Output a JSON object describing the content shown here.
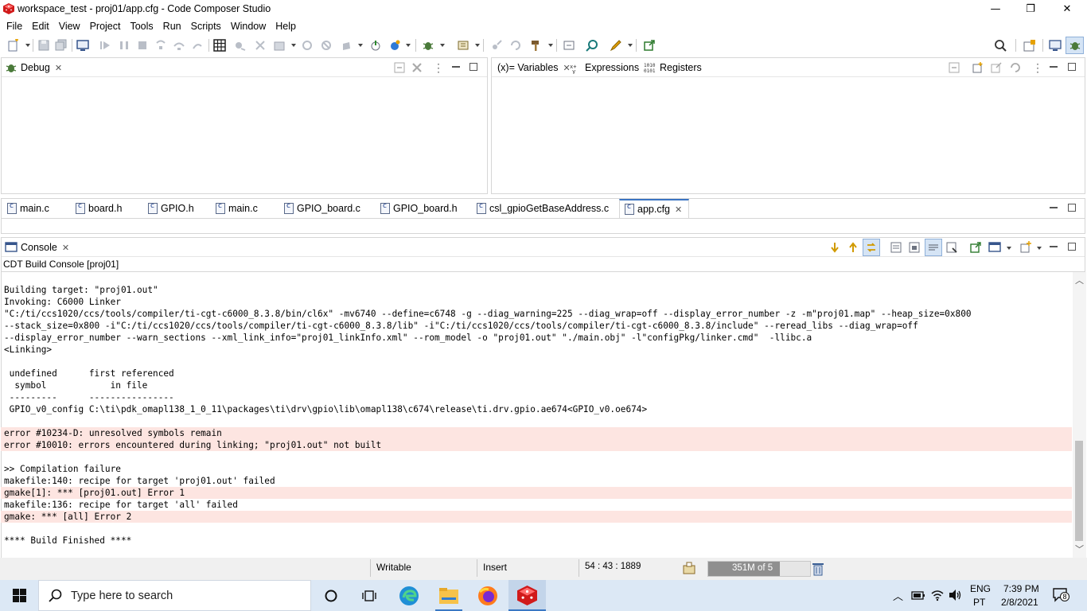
{
  "window": {
    "title": "workspace_test - proj01/app.cfg - Code Composer Studio",
    "minimize": "—",
    "restore": "❐",
    "close": "✕"
  },
  "menu": [
    "File",
    "Edit",
    "View",
    "Project",
    "Tools",
    "Run",
    "Scripts",
    "Window",
    "Help"
  ],
  "debug_view": {
    "tab": "Debug"
  },
  "variables_view": {
    "tabs": [
      "(x)= Variables",
      "Expressions",
      "Registers"
    ]
  },
  "editor": {
    "tabs": [
      "main.c",
      "board.h",
      "GPIO.h",
      "main.c",
      "GPIO_board.c",
      "GPIO_board.h",
      "csl_gpioGetBaseAddress.c",
      "app.cfg"
    ],
    "active_tab": "app.cfg"
  },
  "console": {
    "tab": "Console",
    "subtitle": "CDT Build Console [proj01]",
    "lines": [
      {
        "text": "Building target: \"proj01.out\"",
        "error": false
      },
      {
        "text": "Invoking: C6000 Linker",
        "error": false
      },
      {
        "text": "\"C:/ti/ccs1020/ccs/tools/compiler/ti-cgt-c6000_8.3.8/bin/cl6x\" -mv6740 --define=c6748 -g --diag_warning=225 --diag_wrap=off --display_error_number -z -m\"proj01.map\" --heap_size=0x800",
        "error": false
      },
      {
        "text": "--stack_size=0x800 -i\"C:/ti/ccs1020/ccs/tools/compiler/ti-cgt-c6000_8.3.8/lib\" -i\"C:/ti/ccs1020/ccs/tools/compiler/ti-cgt-c6000_8.3.8/include\" --reread_libs --diag_wrap=off",
        "error": false
      },
      {
        "text": "--display_error_number --warn_sections --xml_link_info=\"proj01_linkInfo.xml\" --rom_model -o \"proj01.out\" \"./main.obj\" -l\"configPkg/linker.cmd\"  -llibc.a",
        "error": false
      },
      {
        "text": "<Linking>",
        "error": false
      },
      {
        "text": "",
        "error": false
      },
      {
        "text": " undefined      first referenced",
        "error": false
      },
      {
        "text": "  symbol            in file",
        "error": false
      },
      {
        "text": " ---------      ----------------",
        "error": false
      },
      {
        "text": " GPIO_v0_config C:\\ti\\pdk_omapl138_1_0_11\\packages\\ti\\drv\\gpio\\lib\\omapl138\\c674\\release\\ti.drv.gpio.ae674<GPIO_v0.oe674>",
        "error": false
      },
      {
        "text": "",
        "error": false
      },
      {
        "text": "error #10234-D: unresolved symbols remain",
        "error": true
      },
      {
        "text": "error #10010: errors encountered during linking; \"proj01.out\" not built",
        "error": true
      },
      {
        "text": "",
        "error": false
      },
      {
        "text": ">> Compilation failure",
        "error": false
      },
      {
        "text": "makefile:140: recipe for target 'proj01.out' failed",
        "error": false
      },
      {
        "text": "gmake[1]: *** [proj01.out] Error 1",
        "error": true
      },
      {
        "text": "makefile:136: recipe for target 'all' failed",
        "error": false
      },
      {
        "text": "gmake: *** [all] Error 2",
        "error": true
      },
      {
        "text": "",
        "error": false
      },
      {
        "text": "**** Build Finished ****",
        "error": false
      }
    ]
  },
  "status": {
    "writable": "Writable",
    "insert": "Insert",
    "position": "54 : 43 : 1889",
    "heap": "351M of 5",
    "heap_fraction": 0.7
  },
  "taskbar": {
    "search_placeholder": "Type here to search",
    "lang_line1": "ENG",
    "lang_line2": "PT",
    "time": "7:39 PM",
    "date": "2/8/2021",
    "notifications": "8"
  },
  "colors": {
    "error_bg": "#fde5e1",
    "taskbar_bg": "#dce8f5",
    "accent": "#e01b1b"
  }
}
